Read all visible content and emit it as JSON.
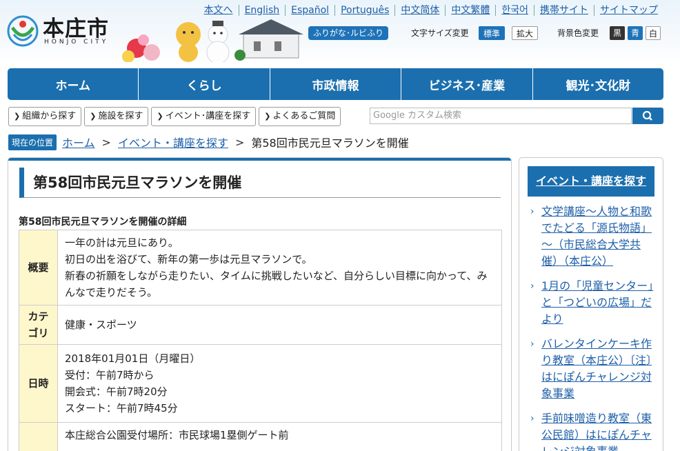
{
  "header": {
    "logo_name": "本庄市",
    "logo_sub": "HONJO CITY",
    "top_links": [
      "本文へ",
      "English",
      "Español",
      "Português",
      "中文简体",
      "中文繁體",
      "한국어",
      "携帯サイト",
      "サイトマップ"
    ],
    "furigana_label": "ふりがな･ルビふり",
    "font_size_label": "文字サイズ変更",
    "font_size_standard": "標準",
    "font_size_large": "拡大",
    "bg_color_label": "背景色変更",
    "bg_black": "黒",
    "bg_blue": "青",
    "bg_white": "白"
  },
  "global_nav": [
    "ホーム",
    "くらし",
    "市政情報",
    "ビジネス･産業",
    "観光･文化財"
  ],
  "sub_nav": [
    "組織から探す",
    "施設を探す",
    "イベント･講座を探す",
    "よくあるご質問"
  ],
  "search": {
    "placeholder": "Google カスタム検索"
  },
  "breadcrumb": {
    "tag": "現在の位置",
    "home": "ホーム",
    "parent": "イベント・講座を探す",
    "current": "第58回市民元旦マラソンを開催"
  },
  "main": {
    "title": "第58回市民元旦マラソンを開催",
    "detail_title": "第58回市民元旦マラソンを開催の詳細",
    "rows": [
      {
        "label": "概要",
        "lines": [
          "一年の計は元旦にあり。",
          "初日の出を浴びて、新年の第一歩は元旦マラソンで。",
          "新春の祈願をしながら走りたい、タイムに挑戦したいなど、自分らしい目標に向かって、みんなで走りだそう。"
        ]
      },
      {
        "label": "カテゴリ",
        "lines": [
          "健康・スポーツ"
        ]
      },
      {
        "label": "日時",
        "lines": [
          "2018年01月01日（月曜日）",
          "受付：午前7時から",
          "開会式：午前7時20分",
          "スタート：午前7時45分"
        ]
      },
      {
        "label": "",
        "lines": [
          "本庄総合公園受付場所：市民球場1塁側ゲート前"
        ]
      }
    ]
  },
  "sidebar": {
    "heading": "イベント・講座を探す",
    "items": [
      "文学講座～人物と和歌でたどる「源氏物語」～（市民総合大学共催）（本庄公）",
      "1月の「児童センター」と「つどいの広場」だより",
      "バレンタインケーキ作り教室（本庄公）〔注〕はにぽんチャレンジ対象事業",
      "手前味噌造り教室（東公民館）はにぽんチャレンジ対象事業"
    ]
  },
  "colors": {
    "brand_blue": "#1b6fae",
    "link": "#1e5fa8",
    "table_header": "#fff7cc"
  }
}
